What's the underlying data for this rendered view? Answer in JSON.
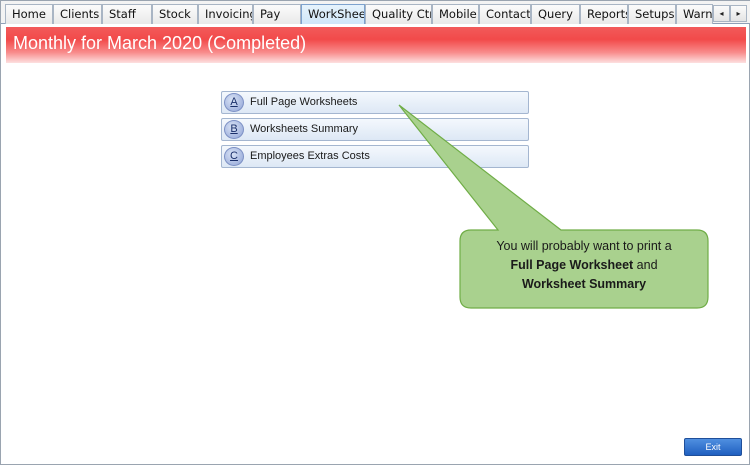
{
  "tabs": [
    {
      "label": "Home"
    },
    {
      "label": "Clients"
    },
    {
      "label": "Staff"
    },
    {
      "label": "Stock"
    },
    {
      "label": "Invoicing"
    },
    {
      "label": "Pay"
    },
    {
      "label": "WorkSheet",
      "active": true
    },
    {
      "label": "Quality Ctrl"
    },
    {
      "label": "Mobile"
    },
    {
      "label": "Contacts"
    },
    {
      "label": "Query"
    },
    {
      "label": "Reports"
    },
    {
      "label": "Setups"
    },
    {
      "label": "Warni"
    }
  ],
  "tab_scroll": {
    "left_icon": "◂",
    "right_icon": "▸"
  },
  "header": {
    "title": "Monthly for March 2020  (Completed)"
  },
  "menu": [
    {
      "key": "A",
      "label": "Full Page Worksheets"
    },
    {
      "key": "B",
      "label": "Worksheets Summary"
    },
    {
      "key": "C",
      "label": "Employees Extras Costs"
    }
  ],
  "callout": {
    "line1": "You will probably want to print a",
    "bold1": "Full Page Worksheet",
    "and": " and",
    "bold2": "Worksheet Summary",
    "fill": "#a9d18e",
    "stroke": "#70ad47"
  },
  "footer": {
    "exit_label": "Exit"
  },
  "colors": {
    "banner": "#f24a4a",
    "active_tab": "#cfe6f8",
    "exit_button": "#1f5fc0"
  }
}
